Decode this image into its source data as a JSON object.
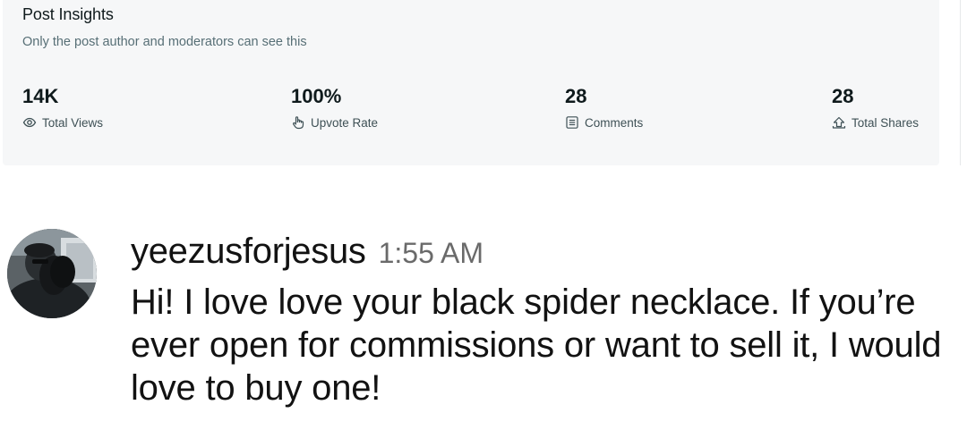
{
  "insights": {
    "title": "Post Insights",
    "subtitle": "Only the post author and moderators can see this",
    "stats": [
      {
        "value": "14K",
        "label": "Total Views",
        "icon": "eye-icon"
      },
      {
        "value": "100%",
        "label": "Upvote Rate",
        "icon": "upvote-hand-icon"
      },
      {
        "value": "28",
        "label": "Comments",
        "icon": "comment-icon"
      },
      {
        "value": "28",
        "label": "Total Shares",
        "icon": "share-icon"
      }
    ]
  },
  "comment": {
    "username": "yeezusforjesus",
    "time": "1:55 AM",
    "text": "Hi!  I love love your black spider necklace. If you’re ever open for commissions or want to sell it, I would love to buy one!",
    "avatar_icon": "user-avatar"
  },
  "colors": {
    "card_background": "#f6f7f8",
    "text_primary": "#0f1a1c",
    "text_secondary": "#576f76",
    "timestamp": "#6a6a6a"
  }
}
